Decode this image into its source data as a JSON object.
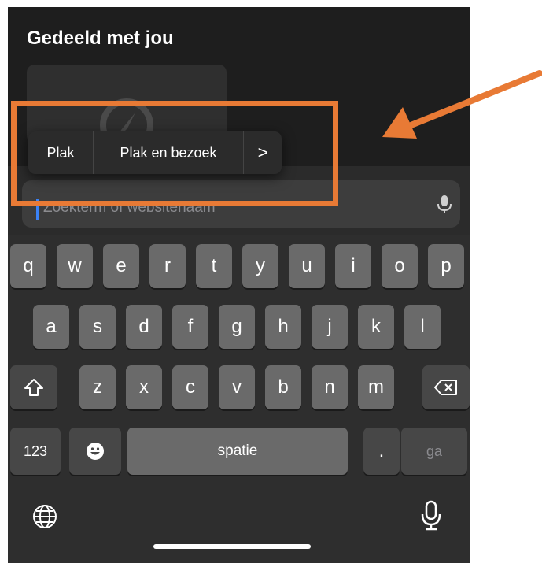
{
  "header": {
    "title": "Gedeeld met jou"
  },
  "context_menu": {
    "items": [
      "Plak",
      "Plak en bezoek",
      ">"
    ]
  },
  "search": {
    "placeholder": "Zoekterm of websitenaam"
  },
  "keyboard": {
    "row1": [
      "q",
      "w",
      "e",
      "r",
      "t",
      "y",
      "u",
      "i",
      "o",
      "p"
    ],
    "row2": [
      "a",
      "s",
      "d",
      "f",
      "g",
      "h",
      "j",
      "k",
      "l"
    ],
    "row3": [
      "z",
      "x",
      "c",
      "v",
      "b",
      "n",
      "m"
    ],
    "numbers_label": "123",
    "space_label": "spatie",
    "period_label": ".",
    "go_label": "ga"
  },
  "icons": [
    "compass-icon",
    "microphone-icon",
    "shift-icon",
    "backspace-icon",
    "emoji-icon",
    "globe-icon",
    "dictation-icon"
  ],
  "colors": {
    "highlight": "#e87a35",
    "caret": "#3a82f7"
  }
}
